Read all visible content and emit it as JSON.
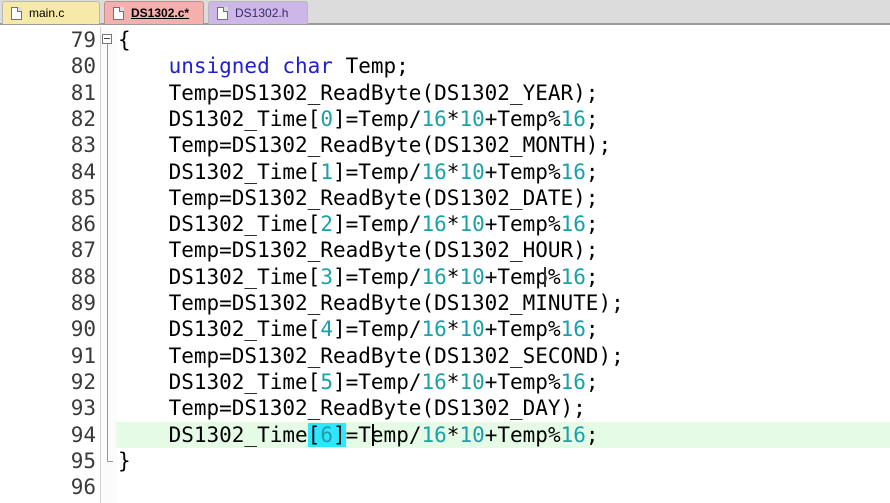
{
  "tabs": [
    {
      "label": "main.c",
      "icon": "file-icon",
      "state": "normal"
    },
    {
      "label": "DS1302.c*",
      "icon": "file-icon",
      "state": "active-modified"
    },
    {
      "label": "DS1302.h",
      "icon": "file-icon",
      "state": "normal"
    }
  ],
  "editor": {
    "current_line": 94,
    "lines": [
      {
        "num": "79",
        "text": "{"
      },
      {
        "num": "80",
        "kw": "unsigned char",
        "rest": " Temp;"
      },
      {
        "num": "81",
        "text": "Temp=DS1302_ReadByte(DS1302_YEAR);"
      },
      {
        "num": "82",
        "pre": "DS1302_Time[",
        "idx": "0",
        "mid": "]=Temp/",
        "n1": "16",
        "op": "*",
        "n2": "10",
        "mid2": "+Temp%",
        "n3": "16",
        "end": ";"
      },
      {
        "num": "83",
        "text": "Temp=DS1302_ReadByte(DS1302_MONTH);"
      },
      {
        "num": "84",
        "pre": "DS1302_Time[",
        "idx": "1",
        "mid": "]=Temp/",
        "n1": "16",
        "op": "*",
        "n2": "10",
        "mid2": "+Temp%",
        "n3": "16",
        "end": ";"
      },
      {
        "num": "85",
        "text": "Temp=DS1302_ReadByte(DS1302_DATE);"
      },
      {
        "num": "86",
        "pre": "DS1302_Time[",
        "idx": "2",
        "mid": "]=Temp/",
        "n1": "16",
        "op": "*",
        "n2": "10",
        "mid2": "+Temp%",
        "n3": "16",
        "end": ";"
      },
      {
        "num": "87",
        "text": "Temp=DS1302_ReadByte(DS1302_HOUR);"
      },
      {
        "num": "88",
        "pre": "DS1302_Time[",
        "idx": "3",
        "mid": "]=Temp/",
        "n1": "16",
        "op": "*",
        "n2": "10",
        "mid2": "+Temp%",
        "n3": "16",
        "end": ";"
      },
      {
        "num": "89",
        "text": "Temp=DS1302_ReadByte(DS1302_MINUTE);"
      },
      {
        "num": "90",
        "pre": "DS1302_Time[",
        "idx": "4",
        "mid": "]=Temp/",
        "n1": "16",
        "op": "*",
        "n2": "10",
        "mid2": "+Temp%",
        "n3": "16",
        "end": ";"
      },
      {
        "num": "91",
        "text": "Temp=DS1302_ReadByte(DS1302_SECOND);"
      },
      {
        "num": "92",
        "pre": "DS1302_Time[",
        "idx": "5",
        "mid": "]=Temp/",
        "n1": "16",
        "op": "*",
        "n2": "10",
        "mid2": "+Temp%",
        "n3": "16",
        "end": ";"
      },
      {
        "num": "93",
        "text": "Temp=DS1302_ReadByte(DS1302_DAY);"
      },
      {
        "num": "94",
        "pre": "DS1302_Time[",
        "idx": "6",
        "mid": "]=Temp/",
        "n1": "16",
        "op": "*",
        "n2": "10",
        "mid2": "+Temp%",
        "n3": "16",
        "end": ";"
      },
      {
        "num": "95",
        "text": "}"
      },
      {
        "num": "96",
        "text": ""
      }
    ]
  }
}
